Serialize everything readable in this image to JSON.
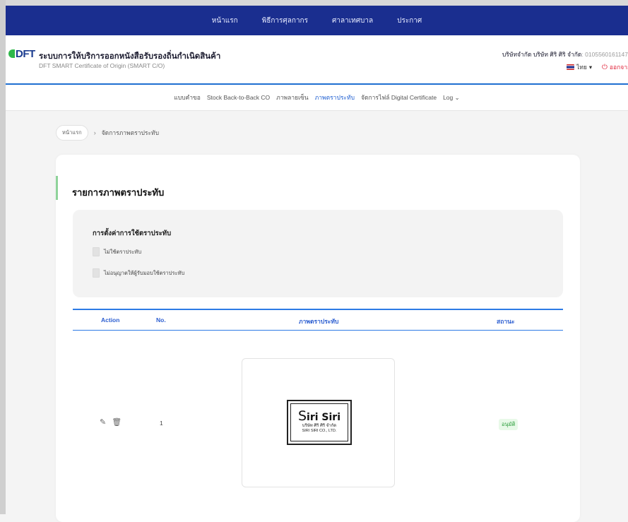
{
  "topnav": {
    "items": [
      "หน้าแรก",
      "พิธีการศุลกากร",
      "ศาลาเทศบาล",
      "ประกาศ"
    ]
  },
  "header": {
    "logo": "DFT",
    "title": "ระบบการให้บริการออกหนังสือรับรองถิ่นกำเนิดสินค้า",
    "subtitle": "DFT SMART Certificate of Origin (SMART C/O)",
    "company": "บริษัทจำกัด บริษัท ศิริ ศิริ จำกัด",
    "tax_id": ": 0105560161147",
    "language": "ไทย",
    "logout": "ออกจากระบบ"
  },
  "subnav": {
    "items": [
      "แบบคำขอ",
      "Stock Back-to-Back CO",
      "ภาพลายเซ็น",
      "ภาพตราประทับ",
      "จัดการไฟล์ Digital Certificate",
      "Log"
    ],
    "active_index": 3
  },
  "breadcrumb": {
    "home": "หน้าแรก",
    "current": "จัดการภาพตราประทับ"
  },
  "card": {
    "title": "รายการภาพตราประทับ",
    "settings": {
      "title": "การตั้งค่าการใช้ตราประทับ",
      "options": [
        "ไม่ใช้ตราประทับ",
        "ไม่อนุญาตให้ผู้รับมอบใช้ตราประทับ"
      ]
    },
    "table": {
      "headers": [
        "Action",
        "No.",
        "ภาพตราประทับ",
        "สถานะ"
      ],
      "rows": [
        {
          "no": "1",
          "status": "อนุมัติ"
        }
      ]
    },
    "stamp": {
      "name_initial": "S",
      "name_rest": "iri Siri",
      "thai_text": "บริษัท ศิริ ศิริ จำกัด",
      "english_text": "SIRI SIRI CO., LTD."
    }
  },
  "colors": {
    "nav_bg": "#1a2e8f",
    "accent": "#2d7be5",
    "approved": "#2a9d3a",
    "logout": "#e0263c"
  },
  "icons": {
    "edit": "pencil-icon",
    "delete": "trash-icon",
    "chevron": "chevron-down-icon",
    "power": "power-icon"
  }
}
